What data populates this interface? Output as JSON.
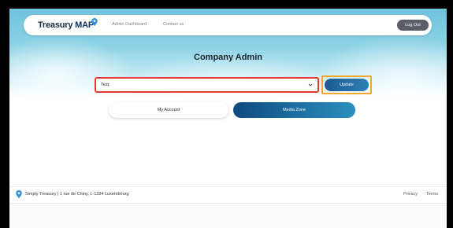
{
  "nav": {
    "logo_prefix": "Treasury ",
    "logo_suffix": "MAP",
    "links": [
      "Admin Dashboard",
      "Contact us"
    ],
    "logout_label": "Log Out"
  },
  "page": {
    "title": "Company Admin",
    "company_select": {
      "value": "Test"
    },
    "update_label": "Update",
    "tabs": [
      {
        "label": "My Account",
        "active": false
      },
      {
        "label": "Media Zone",
        "active": true
      }
    ]
  },
  "footer": {
    "address": "Simply Treasury | 1 rue de Chiny, L-1334 Luxembourg",
    "links": [
      "Privacy",
      "Terms"
    ]
  },
  "colors": {
    "brand_blue": "#1a5b93",
    "highlight_red": "#e53935",
    "highlight_orange": "#f0a830"
  },
  "icons": [
    "location-pin-icon",
    "chevron-down-icon"
  ]
}
